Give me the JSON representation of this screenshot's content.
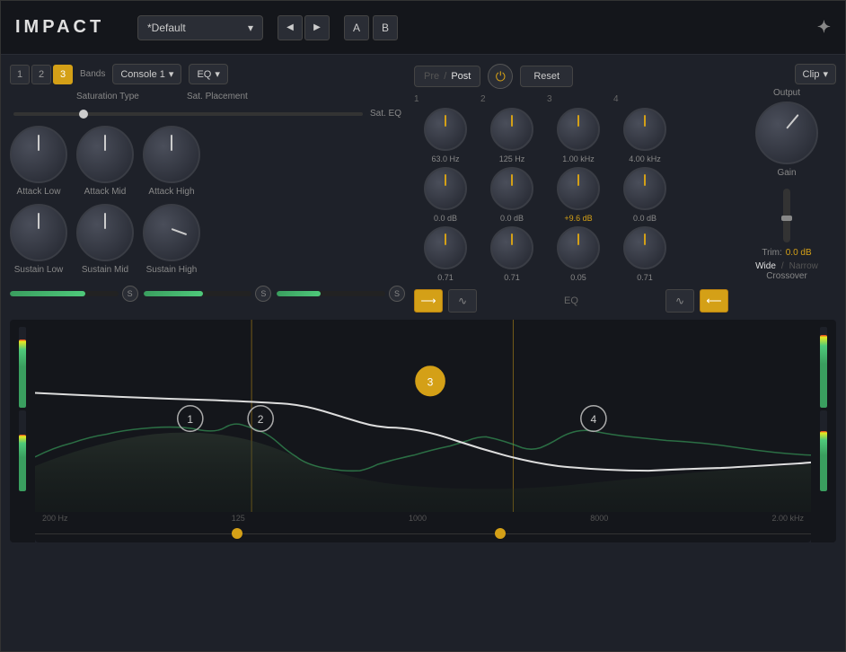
{
  "header": {
    "logo": "IMPACT",
    "preset": "*Default",
    "nav_prev": "◀",
    "nav_next": "▶",
    "ab_a": "A",
    "ab_b": "B",
    "steinberg_icon": "✦"
  },
  "bands": {
    "label": "Bands",
    "buttons": [
      "1",
      "2",
      "3"
    ],
    "active_index": 2
  },
  "saturation": {
    "type_label": "Saturation Type",
    "type_value": "Console 1",
    "placement_label": "Sat. Placement",
    "placement_value": "EQ",
    "eq_label": "Sat. EQ"
  },
  "knobs": {
    "attack_low_label": "Attack Low",
    "attack_mid_label": "Attack Mid",
    "attack_high_label": "Attack High",
    "sustain_low_label": "Sustain Low",
    "sustain_mid_label": "Sustain Mid",
    "sustain_high_label": "Sustain High"
  },
  "eq_section": {
    "pre_label": "Pre",
    "post_label": "Post",
    "separator": "/",
    "reset_label": "Reset",
    "label": "EQ",
    "bands": [
      {
        "num": "1",
        "freq": "63.0 Hz",
        "db": "0.0 dB",
        "q": "0.71",
        "db_active": false
      },
      {
        "num": "2",
        "freq": "125 Hz",
        "db": "0.0 dB",
        "q": "0.71",
        "db_active": false
      },
      {
        "num": "3",
        "freq": "1.00 kHz",
        "db": "+9.6 dB",
        "q": "0.05",
        "db_active": true
      },
      {
        "num": "4",
        "freq": "4.00 kHz",
        "db": "0.0 dB",
        "q": "0.71",
        "db_active": false
      }
    ]
  },
  "output": {
    "clip_label": "Clip",
    "output_label": "Output",
    "gain_label": "Gain",
    "trim_label": "Trim:",
    "trim_value": "0.0 dB",
    "wide_label": "Wide",
    "narrow_label": "Narrow",
    "separator": "/",
    "crossover_label": "Crossover"
  },
  "meters": [
    {
      "fill_pct": 70,
      "circle": "S"
    },
    {
      "fill_pct": 55,
      "circle": "S"
    },
    {
      "fill_pct": 40,
      "circle": "S"
    }
  ],
  "spectrum": {
    "freq_labels": [
      "200 Hz",
      "",
      "125",
      "",
      "1000",
      "",
      "",
      "8000",
      "",
      "2.00 kHz"
    ],
    "crossover_left_pct": 28,
    "crossover_right_pct": 62,
    "band_nodes": [
      {
        "id": "1",
        "x_pct": 20,
        "y_pct": 52
      },
      {
        "id": "2",
        "x_pct": 29,
        "y_pct": 52
      },
      {
        "id": "3",
        "x_pct": 51,
        "y_pct": 32
      },
      {
        "id": "4",
        "x_pct": 72,
        "y_pct": 52
      }
    ]
  },
  "vu_left": {
    "fill1": 85,
    "fill2": 70
  },
  "vu_right": {
    "fill1": 90,
    "fill2": 75
  }
}
